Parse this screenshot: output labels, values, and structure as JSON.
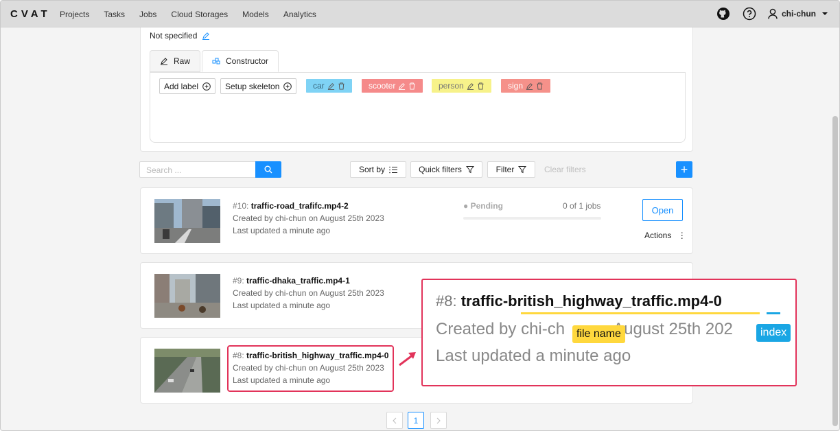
{
  "nav": {
    "logo": "CVAT",
    "items": [
      "Projects",
      "Tasks",
      "Jobs",
      "Cloud Storages",
      "Models",
      "Analytics"
    ],
    "user": "chi-chun"
  },
  "project": {
    "bug_tracker": "Not specified",
    "tabs": [
      "Raw",
      "Constructor"
    ],
    "add_label": "Add label",
    "setup_skeleton": "Setup skeleton",
    "labels": [
      {
        "name": "car",
        "color": "#7fd3f5"
      },
      {
        "name": "scooter",
        "color": "#f58a8a"
      },
      {
        "name": "person",
        "color": "#f7f28a"
      },
      {
        "name": "sign",
        "color": "#f5918a"
      }
    ]
  },
  "toolbar": {
    "search_placeholder": "Search ...",
    "sort_by": "Sort by",
    "quick_filters": "Quick filters",
    "filter": "Filter",
    "clear_filters": "Clear filters"
  },
  "tasks": [
    {
      "id": "#10:",
      "name": "traffic-road_trafifc.mp4-2",
      "created": "Created by chi-chun on August 25th 2023",
      "updated": "Last updated a minute ago",
      "status": "Pending",
      "jobs": "0 of 1 jobs",
      "open": "Open",
      "actions": "Actions"
    },
    {
      "id": "#9:",
      "name": "traffic-dhaka_traffic.mp4-1",
      "created": "Created by chi-chun on August 25th 2023",
      "updated": "Last updated a minute ago"
    },
    {
      "id": "#8:",
      "name": "traffic-british_highway_traffic.mp4-0",
      "created": "Created by chi-chun on August 25th 2023",
      "updated": "Last updated a minute ago"
    }
  ],
  "callout": {
    "id": "#8:",
    "name": "traffic-british_highway_traffic.mp4-",
    "index": "0",
    "created": "Created by chi-ch",
    "created_tail": "August 25th 202",
    "updated": "Last updated a minute ago",
    "tag_file": "file name",
    "tag_index": "index"
  },
  "pagination": {
    "current": "1"
  },
  "colors": {
    "accent": "#1890ff",
    "highlight": "#e2335a",
    "tag_yellow": "#ffd83d",
    "tag_blue": "#1aa6e4"
  }
}
